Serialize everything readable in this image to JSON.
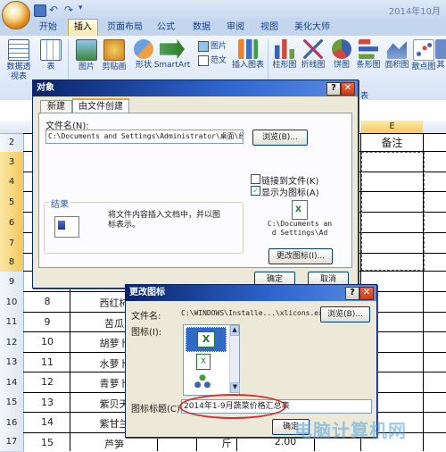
{
  "app": {
    "title": "2014年10月",
    "tabs": [
      "开始",
      "插入",
      "页面布局",
      "公式",
      "数据",
      "审阅",
      "视图",
      "美化大师"
    ],
    "active_tab": "插入"
  },
  "ribbon": {
    "pivot_label": "数据透视表",
    "table_label": "表",
    "picture_label": "图片",
    "clipart_label": "剪贴画",
    "shapes_label": "形状",
    "smartart_label": "SmartArt",
    "pic_small": "图片",
    "fancy_text": "范文",
    "insert_chart": "插入图表",
    "bar_chart": "柱形图",
    "line_chart": "折线图",
    "pie_chart": "饼图",
    "barh_chart": "条形图",
    "area_chart": "面积图",
    "scatter_chart": "散点图",
    "other_chart": "其",
    "group_chart_label": "表"
  },
  "sheet": {
    "col_e_label": "E",
    "note_header": "备注",
    "row_headers": [
      "2",
      "3",
      "4",
      "5",
      "6",
      "7",
      "8",
      "9",
      "10",
      "11",
      "12",
      "13",
      "14",
      "15",
      "16",
      "17"
    ],
    "rows": [
      {
        "num": "8",
        "name": "西红柿"
      },
      {
        "num": "9",
        "name": "苦瓜"
      },
      {
        "num": "10",
        "name": "胡萝卜"
      },
      {
        "num": "11",
        "name": "水萝卜"
      },
      {
        "num": "12",
        "name": "青萝卜"
      },
      {
        "num": "13",
        "name": "紫贝天"
      },
      {
        "num": "14",
        "name": "紫甘兰"
      },
      {
        "num": "15",
        "name": "芦笋"
      }
    ],
    "partial_row17_unit": "斤",
    "partial_row17_price": "2.00"
  },
  "object_dialog": {
    "title": "对象",
    "tab_new": "新建",
    "tab_from_file": "由文件创建",
    "filename_label": "文件名(N):",
    "filename_value": "C:\\Documents and Settings\\Administrator\\桌面\\经验\\",
    "browse_button": "浏览(B)...",
    "link_label": "链接到文件(K)",
    "link_checked": false,
    "display_icon_label": "显示为图标(A)",
    "display_icon_checked": true,
    "result_label": "结果",
    "result_text": "将文件内容插入文档中，并以图标表示。",
    "icon_caption": "C:\\Documents and Settings\\Ad",
    "change_icon_button": "更改图标(I)...",
    "ok_button": "确定",
    "cancel_button": "取消"
  },
  "change_icon_dialog": {
    "title": "更改图标",
    "filename_label": "文件名:",
    "filename_value": "C:\\WINDOWS\\Installe...\\xlicons.exe",
    "browse_button": "浏览(B)...",
    "icon_label": "图标(I):",
    "caption_label": "图标标题(C):",
    "caption_value": "2014年1-9月蔬菜价格汇总表",
    "ok_button": "确定"
  },
  "watermark": "电脑计算机网",
  "colors": {
    "title_blue": "#0a246a",
    "highlight_red": "#d03030",
    "ribbon_text": "#15428b"
  }
}
